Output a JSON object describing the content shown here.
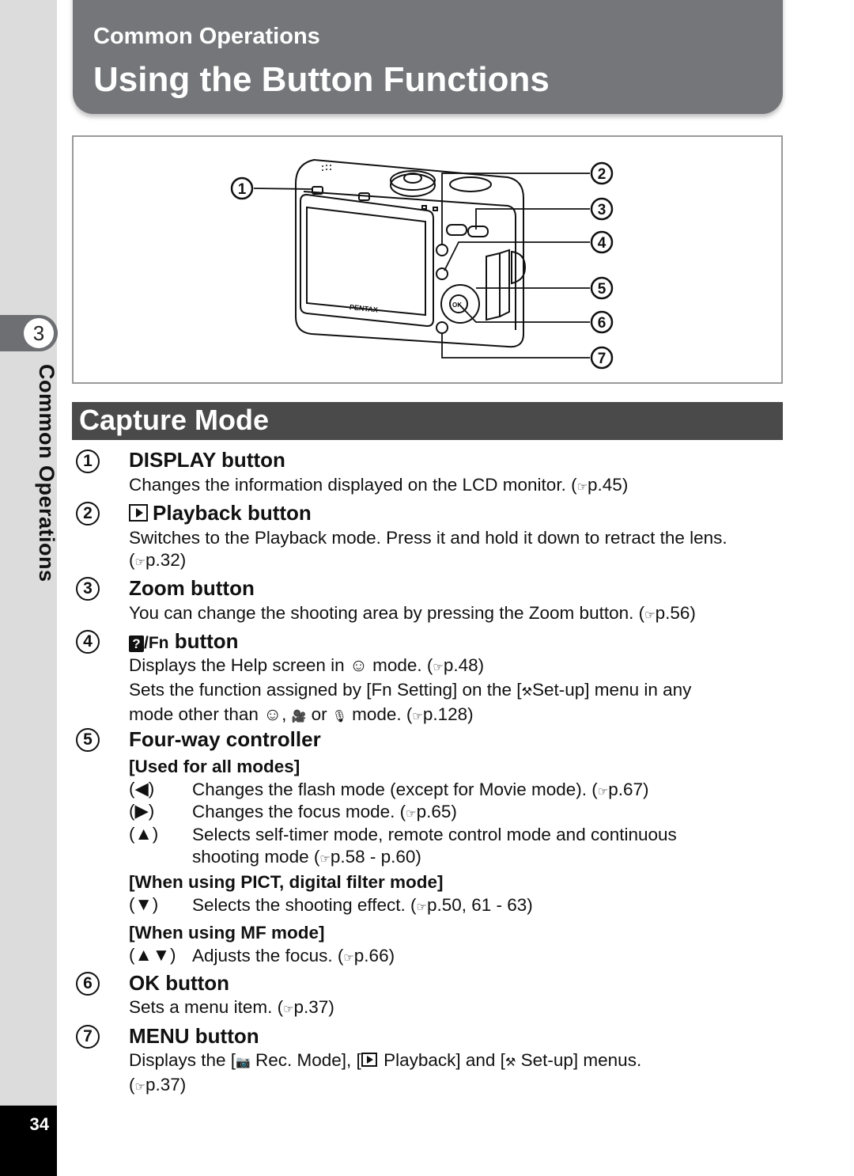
{
  "header": {
    "subtitle": "Common Operations",
    "title": "Using the Button Functions"
  },
  "side": {
    "chapter_number": "3",
    "chapter_label": "Common Operations",
    "page_number": "34"
  },
  "illustration": {
    "brand": "PENTAX",
    "ok_label": "OK",
    "callouts": [
      "1",
      "2",
      "3",
      "4",
      "5",
      "6",
      "7"
    ]
  },
  "section": {
    "title": "Capture Mode"
  },
  "ref_icon": "☞",
  "items": [
    {
      "number": "1",
      "title": "DISPLAY button",
      "lines": [
        "Changes the information displayed on the LCD monitor. (",
        "p.45)"
      ]
    },
    {
      "number": "2",
      "icon": "playback-icon",
      "title": "Playback button",
      "lines": [
        "Switches to the Playback mode. Press it and hold it down to retract the lens.",
        "(",
        "p.32)"
      ]
    },
    {
      "number": "3",
      "title": "Zoom button",
      "lines": [
        "You can change the shooting area by pressing the Zoom button. (",
        "p.56)"
      ]
    },
    {
      "number": "4",
      "icon": "help-icon",
      "icon_text": "?",
      "title_prefix": "/Fn",
      "title": " button",
      "lines": [
        "Displays the Help screen in ",
        " mode. (",
        "p.48)",
        "Sets the function assigned by [Fn Setting] on the [",
        "Set-up] menu in any",
        "mode other than ",
        ", ",
        " or ",
        " mode. (",
        "p.128)"
      ]
    },
    {
      "number": "5",
      "title": "Four-way controller",
      "groups": [
        {
          "heading": "[Used for all modes]",
          "rows": [
            {
              "key": "(◀)",
              "text": "Changes the flash mode (except for Movie mode). (",
              "ref": "p.67)"
            },
            {
              "key": "(▶)",
              "text": "Changes the focus mode. (",
              "ref": "p.65)"
            },
            {
              "key": "(▲)",
              "text": "Selects self-timer mode, remote control mode and continuous",
              "text2": "shooting mode (",
              "ref": "p.58 - p.60)"
            }
          ]
        },
        {
          "heading": "[When using PICT, digital filter mode]",
          "rows": [
            {
              "key": "(▼)",
              "text": "Selects the shooting effect. (",
              "ref": "p.50, 61 - 63)"
            }
          ]
        },
        {
          "heading": "[When using MF mode]",
          "rows": [
            {
              "key": "(▲▼)",
              "text": "Adjusts the focus. (",
              "ref": "p.66)"
            }
          ]
        }
      ]
    },
    {
      "number": "6",
      "title": "OK button",
      "lines": [
        "Sets a menu item. (",
        "p.37)"
      ]
    },
    {
      "number": "7",
      "title": "MENU button",
      "lines": [
        "Displays the [",
        " Rec. Mode], [",
        " Playback] and [",
        " Set-up] menus.",
        "(",
        "p.37)"
      ]
    }
  ],
  "glyphs": {
    "smile": "☺",
    "movie": "🎥",
    "mic": "🎙",
    "camera": "📷",
    "wrench": "⚒"
  }
}
